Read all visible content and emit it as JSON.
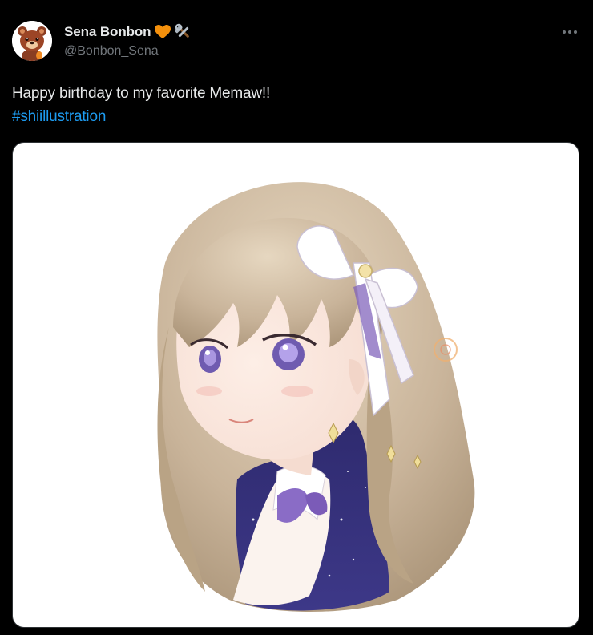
{
  "author": {
    "display_name": "Sena Bonbon",
    "handle": "@Bonbon_Sena",
    "avatar_icon": "bear-avatar-icon",
    "badges": [
      "orange-heart-icon",
      "hammer-and-wrench-icon"
    ]
  },
  "tweet": {
    "text": "Happy birthday to my favorite Memaw!!",
    "hashtag": "#shiillustration"
  },
  "media": {
    "type": "illustration",
    "description_icon": "anime-girl-illustration"
  },
  "menu": {
    "more_icon": "more-options-icon"
  },
  "colors": {
    "background": "#000000",
    "text": "#e7e9ea",
    "secondary_text": "#71767b",
    "link": "#1d9bf0",
    "heart": "#f4900c"
  }
}
